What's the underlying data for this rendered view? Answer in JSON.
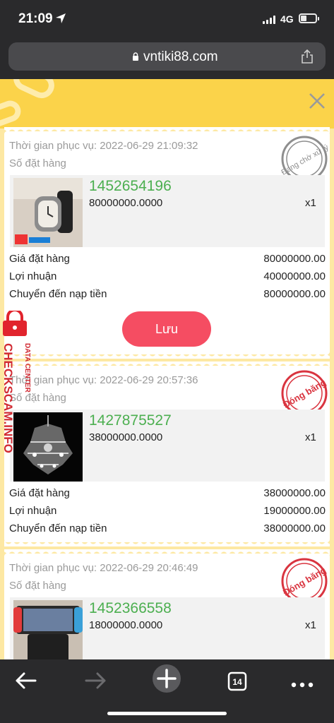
{
  "status_bar": {
    "time": "21:09",
    "network": "4G"
  },
  "browser": {
    "url": "vntiki88.com",
    "tab_count": "14"
  },
  "orders": [
    {
      "service_time": "Thời gian phục vụ: 2022-06-29 21:09:32",
      "order_label": "Số đặt hàng",
      "stamp_text": "Đang chờ xử lý",
      "product_id": "1452654196",
      "price": "80000000.0000",
      "qty": "x1",
      "rows": [
        {
          "label": "Giá đặt hàng",
          "value": "80000000.00"
        },
        {
          "label": "Lợi nhuận",
          "value": "40000000.00"
        },
        {
          "label": "Chuyển đến nạp tiền",
          "value": "80000000.00"
        }
      ],
      "button": "Lưu"
    },
    {
      "service_time": "Thời gian phục vụ: 2022-06-29 20:57:36",
      "order_label": "Số đặt hàng",
      "stamp_text": "Đóng băng",
      "product_id": "1427875527",
      "price": "38000000.0000",
      "qty": "x1",
      "rows": [
        {
          "label": "Giá đặt hàng",
          "value": "38000000.00"
        },
        {
          "label": "Lợi nhuận",
          "value": "19000000.00"
        },
        {
          "label": "Chuyển đến nạp tiền",
          "value": "38000000.00"
        }
      ]
    },
    {
      "service_time": "Thời gian phục vụ: 2022-06-29 20:46:49",
      "order_label": "Số đặt hàng",
      "stamp_text": "Đóng băng",
      "product_id": "1452366558",
      "price": "18000000.0000",
      "qty": "x1"
    }
  ],
  "watermark": {
    "line1": "DATA CENTER",
    "line2": "CHECKSCAM.INFO"
  },
  "colors": {
    "accent_green": "#4caf50",
    "button_red": "#f54d62",
    "stamp_red": "#d9343f",
    "page_bg": "#fde8a3"
  },
  "icons": [
    "location-arrow-icon",
    "lock-icon",
    "share-icon",
    "close-icon",
    "back-arrow-icon",
    "forward-arrow-icon",
    "new-tab-plus-icon",
    "tabs-icon",
    "more-icon"
  ]
}
